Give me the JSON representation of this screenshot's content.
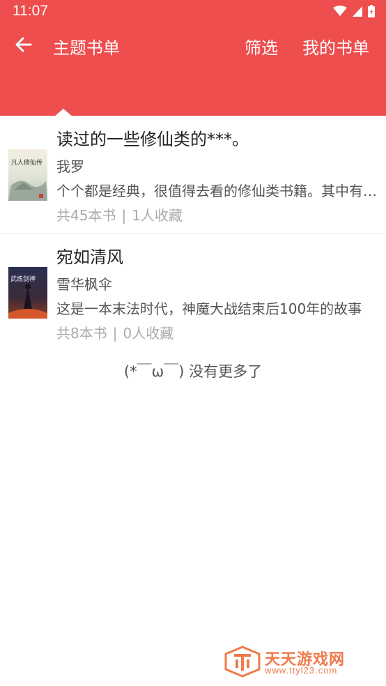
{
  "status_bar": {
    "time": "11:07"
  },
  "toolbar": {
    "title": "主题书单",
    "filter_label": "筛选",
    "my_list_label": "我的书单"
  },
  "booklists": [
    {
      "title": "读过的一些修仙类的***。",
      "author": "我罗",
      "description": "个个都是经典，很值得去看的修仙类书籍。其中有些已完结",
      "book_count": "共45本书",
      "collect_count": "1人收藏",
      "cover_text": "凡人修仙传"
    },
    {
      "title": "宛如清风",
      "author": "雪华枫伞",
      "description": "这是一本末法时代，神魔大战结束后100年的故事",
      "book_count": "共8本书",
      "collect_count": "0人收藏",
      "cover_text": "武炼剑神"
    }
  ],
  "meta_separator": "|",
  "no_more_text": "(*￣ω￣) 没有更多了",
  "watermark": {
    "name": "天天游戏网",
    "url": "www.ttyl23.com"
  },
  "colors": {
    "header": "#ee4e4e",
    "watermark": "#f07a4a"
  }
}
